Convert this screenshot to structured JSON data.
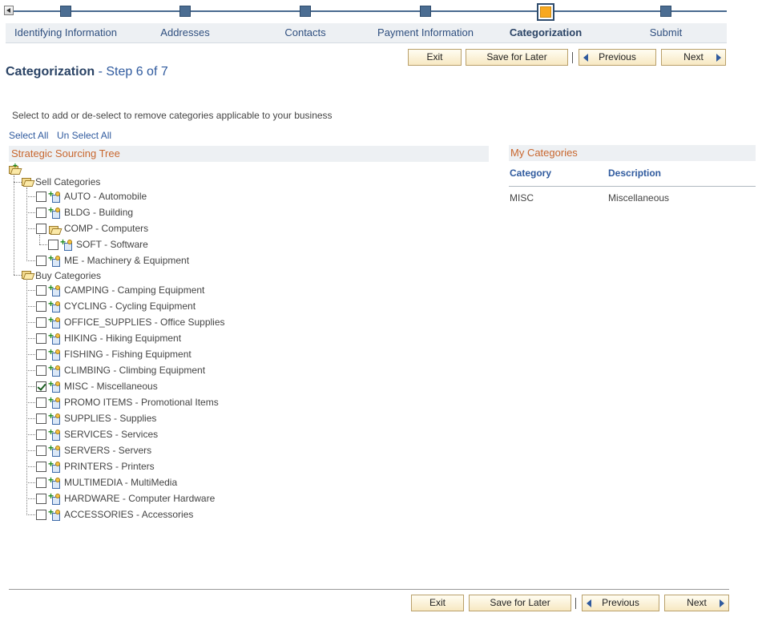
{
  "stepper": {
    "steps": [
      {
        "label": "Identifying Information"
      },
      {
        "label": "Addresses"
      },
      {
        "label": "Contacts"
      },
      {
        "label": "Payment Information"
      },
      {
        "label": "Categorization"
      },
      {
        "label": "Submit"
      }
    ],
    "active_index": 4
  },
  "buttons": {
    "exit": "Exit",
    "save_for_later": "Save for Later",
    "previous": "Previous",
    "next": "Next"
  },
  "page": {
    "title": "Categorization",
    "step": "- Step 6 of 7",
    "instructions": "Select to add or de-select to remove categories applicable to your business",
    "select_all": "Select All",
    "unselect_all": "Un Select All"
  },
  "tree": {
    "header": "Strategic Sourcing Tree",
    "sell_label": "Sell Categories",
    "sell": [
      {
        "label": "AUTO - Automobile",
        "checked": false
      },
      {
        "label": "BLDG - Building",
        "checked": false
      },
      {
        "label": "COMP - Computers",
        "checked": false,
        "folder": true
      },
      {
        "label": "SOFT - Software",
        "checked": false,
        "child": true
      },
      {
        "label": "ME - Machinery & Equipment",
        "checked": false
      }
    ],
    "buy_label": "Buy Categories",
    "buy": [
      {
        "label": "CAMPING - Camping Equipment",
        "checked": false
      },
      {
        "label": "CYCLING - Cycling Equipment",
        "checked": false
      },
      {
        "label": "OFFICE_SUPPLIES - Office Supplies",
        "checked": false
      },
      {
        "label": "HIKING - Hiking Equipment",
        "checked": false
      },
      {
        "label": "FISHING - Fishing Equipment",
        "checked": false
      },
      {
        "label": "CLIMBING - Climbing Equipment",
        "checked": false
      },
      {
        "label": "MISC - Miscellaneous",
        "checked": true
      },
      {
        "label": "PROMO ITEMS - Promotional Items",
        "checked": false
      },
      {
        "label": "SUPPLIES - Supplies",
        "checked": false
      },
      {
        "label": "SERVICES - Services",
        "checked": false
      },
      {
        "label": "SERVERS - Servers",
        "checked": false
      },
      {
        "label": "PRINTERS - Printers",
        "checked": false
      },
      {
        "label": "MULTIMEDIA - MultiMedia",
        "checked": false
      },
      {
        "label": "HARDWARE - Computer Hardware",
        "checked": false
      },
      {
        "label": "ACCESSORIES - Accessories",
        "checked": false
      }
    ]
  },
  "my_categories": {
    "header": "My Categories",
    "col_category": "Category",
    "col_description": "Description",
    "rows": [
      {
        "category": "MISC",
        "description": "Miscellaneous"
      }
    ]
  }
}
